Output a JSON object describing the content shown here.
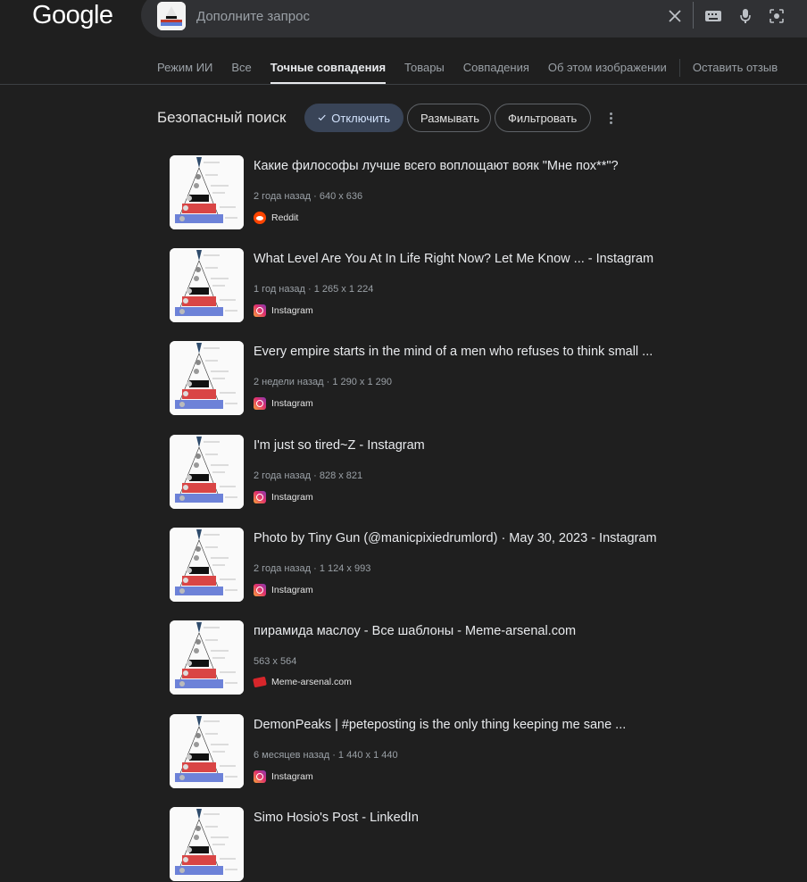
{
  "header": {
    "logo": "Google",
    "search_placeholder": "Дополните запрос"
  },
  "tabs": [
    {
      "label": "Режим ИИ"
    },
    {
      "label": "Все"
    },
    {
      "label": "Точные совпадения",
      "active": true
    },
    {
      "label": "Товары"
    },
    {
      "label": "Совпадения"
    },
    {
      "label": "Об этом изображении"
    },
    {
      "label": "Оставить отзыв"
    }
  ],
  "safe_search": {
    "label": "Безопасный поиск",
    "options": [
      "Отключить",
      "Размывать",
      "Фильтровать"
    ],
    "selected": "Отключить"
  },
  "results": [
    {
      "title": "Какие философы лучше всего воплощают вояк \"Мне пох**\"?",
      "meta": "2 года назад · 640 x 636",
      "source": "Reddit",
      "source_icon": "reddit-icon"
    },
    {
      "title": "What Level Are You At In Life Right Now? Let Me Know ... - Instagram",
      "meta": "1 год назад · 1 265 x 1 224",
      "source": "Instagram",
      "source_icon": "instagram-icon"
    },
    {
      "title": "Every empire starts in the mind of a men who refuses to think small ...",
      "meta": "2 недели назад · 1 290 x 1 290",
      "source": "Instagram",
      "source_icon": "instagram-icon"
    },
    {
      "title": "I'm just so tired~Z - Instagram",
      "meta": "2 года назад · 828 x 821",
      "source": "Instagram",
      "source_icon": "instagram-icon"
    },
    {
      "title": "Photo by Tiny Gun (@manicpixiedrumlord) · May 30, 2023 - Instagram",
      "meta": "2 года назад · 1 124 x 993",
      "source": "Instagram",
      "source_icon": "instagram-icon"
    },
    {
      "title": "пирамида маслоу - Все шаблоны - Meme-arsenal.com",
      "meta": "563 x 564",
      "source": "Meme-arsenal.com",
      "source_icon": "meme-arsenal-icon"
    },
    {
      "title": "DemonPeaks | #peteposting is the only thing keeping me sane ...",
      "meta": "6 месяцев назад · 1 440 x 1 440",
      "source": "Instagram",
      "source_icon": "instagram-icon"
    },
    {
      "title": "Simo Hosio's Post - LinkedIn",
      "meta": "",
      "source": "",
      "source_icon": ""
    }
  ]
}
